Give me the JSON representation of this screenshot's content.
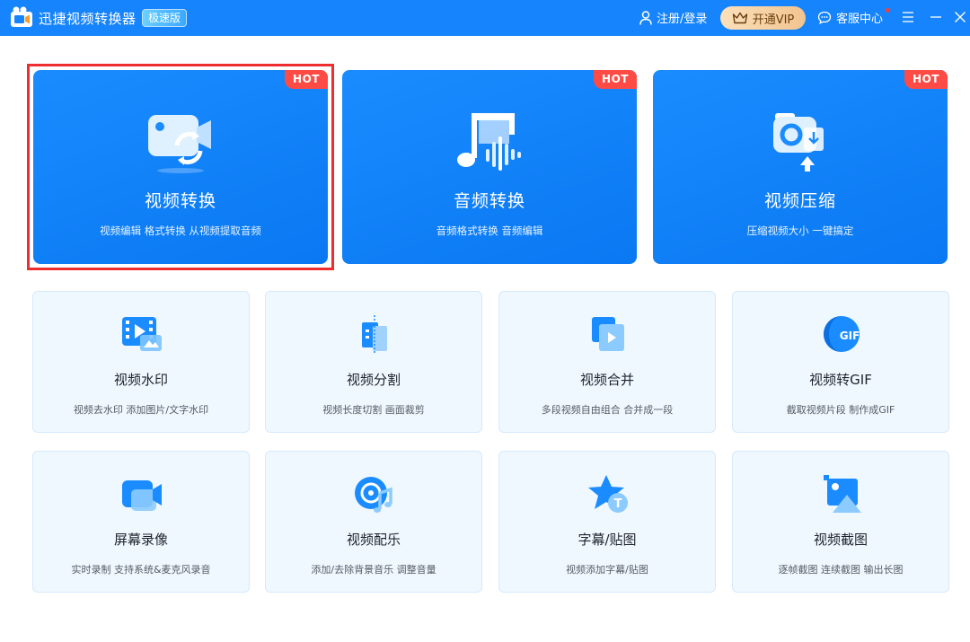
{
  "app": {
    "title": "迅捷视频转换器",
    "edition": "极速版"
  },
  "header": {
    "login_label": "注册/登录",
    "vip_label": "开通VIP",
    "service_label": "客服中心"
  },
  "colors": {
    "brand": "#1684fc",
    "hot_badge": "#ff4b45",
    "selected_outline": "#ee2e2e"
  },
  "featured": [
    {
      "badge": "HOT",
      "title": "视频转换",
      "desc": "视频编辑 格式转换 从视频提取音频",
      "icon": "video-convert-icon",
      "selected": true
    },
    {
      "badge": "HOT",
      "title": "音频转换",
      "desc": "音频格式转换 音频编辑",
      "icon": "audio-convert-icon",
      "selected": false
    },
    {
      "badge": "HOT",
      "title": "视频压缩",
      "desc": "压缩视频大小 一键搞定",
      "icon": "video-compress-icon",
      "selected": false
    }
  ],
  "tools": [
    {
      "title": "视频水印",
      "desc": "视频去水印 添加图片/文字水印",
      "icon": "video-watermark-icon"
    },
    {
      "title": "视频分割",
      "desc": "视频长度切割 画面裁剪",
      "icon": "video-split-icon"
    },
    {
      "title": "视频合并",
      "desc": "多段视频自由组合 合并成一段",
      "icon": "video-merge-icon"
    },
    {
      "title": "视频转GIF",
      "desc": "截取视频片段 制作成GIF",
      "icon": "video-to-gif-icon",
      "icon_text": "GIF"
    },
    {
      "title": "屏幕录像",
      "desc": "实时录制 支持系统&麦克风录音",
      "icon": "screen-record-icon"
    },
    {
      "title": "视频配乐",
      "desc": "添加/去除背景音乐 调整音量",
      "icon": "video-music-icon"
    },
    {
      "title": "字幕/贴图",
      "desc": "视频添加字幕/贴图",
      "icon": "subtitle-sticker-icon",
      "icon_text": "T"
    },
    {
      "title": "视频截图",
      "desc": "逐帧截图 连续截图 输出长图",
      "icon": "video-screenshot-icon"
    }
  ]
}
